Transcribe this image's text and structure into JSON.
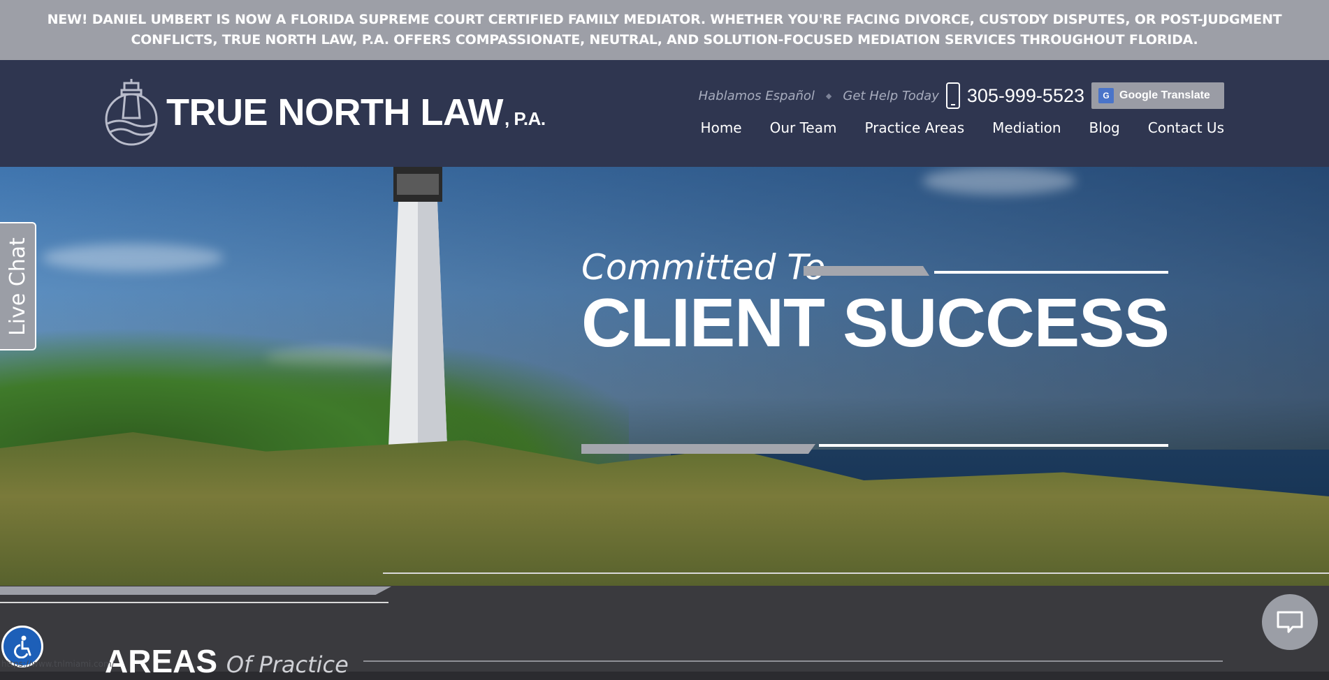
{
  "announcement": {
    "text": "NEW! DANIEL UMBERT IS NOW A FLORIDA SUPREME COURT CERTIFIED FAMILY MEDIATOR. WHETHER YOU'RE FACING DIVORCE, CUSTODY DISPUTES, OR POST-JUDGMENT CONFLICTS, TRUE NORTH LAW, P.A. OFFERS COMPASSIONATE, NEUTRAL, AND SOLUTION-FOCUSED MEDIATION SERVICES THROUGHOUT FLORIDA."
  },
  "header": {
    "logo_text": "TRUE NORTH LAW",
    "logo_suffix": ", P.A.",
    "tagline_1": "Hablamos Español",
    "tagline_2": "Get Help Today",
    "phone": "305-999-5523",
    "translate_label": "Google Translate",
    "nav": [
      "Home",
      "Our Team",
      "Practice Areas",
      "Mediation",
      "Blog",
      "Contact Us"
    ]
  },
  "hero": {
    "line1": "Committed To",
    "line2": "CLIENT SUCCESS"
  },
  "livechat": {
    "label": "Live Chat"
  },
  "areas": {
    "title": "AREAS",
    "subtitle": "Of Practice"
  },
  "status_url": "https://www.tnlmiami.com/",
  "colors": {
    "announcement_bg": "#9d9fa7",
    "header_bg": "#2f3650",
    "accent_grey": "#a4a6ad",
    "accessibility_blue": "#1d5fb8"
  },
  "icons": [
    "lighthouse-logo-icon",
    "phone-icon",
    "google-translate-icon",
    "chat-bubble-icon",
    "accessibility-icon"
  ]
}
